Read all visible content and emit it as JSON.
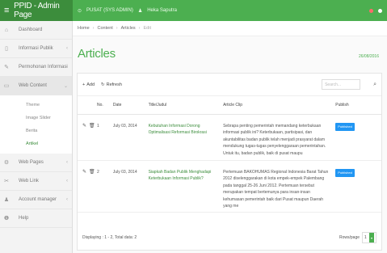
{
  "app": {
    "title": "PPID - Admin Page"
  },
  "topnav": {
    "org": "PUSAT (SYS ADMIN)",
    "user": "Heka Saputra"
  },
  "sidebar": {
    "items": [
      {
        "label": "Dashboard",
        "icon": "home-icon"
      },
      {
        "label": "Informasi Publik",
        "icon": "file-icon"
      },
      {
        "label": "Permohonan Informasi",
        "icon": "edit-icon"
      },
      {
        "label": "Web Content",
        "icon": "document-icon"
      },
      {
        "label": "Web Pages",
        "icon": "gear-icon"
      },
      {
        "label": "Web Link",
        "icon": "link-icon"
      },
      {
        "label": "Account manager",
        "icon": "user-icon"
      },
      {
        "label": "Help",
        "icon": "info-icon"
      }
    ],
    "submenu": [
      "Theme",
      "Image Slider",
      "Berita",
      "Artikel"
    ]
  },
  "breadcrumb": {
    "home": "Home",
    "content": "Content",
    "articles": "Articles",
    "edit": "Edit"
  },
  "page": {
    "title": "Articles",
    "date": "26/08/2016"
  },
  "toolbar": {
    "add": "Add",
    "refresh": "Refresh",
    "search_placeholder": "Search..."
  },
  "table": {
    "headers": [
      "No.",
      "Date",
      "Title/Judul",
      "Article Clip",
      "Publish"
    ],
    "rows": [
      {
        "no": "1",
        "date": "July 03, 2014",
        "title": "Kebutuhan Informasi Dorong Optimalisasi Reformasi Birokrasi",
        "clip": "Sebrapa penting pemerintah memandang keterbukaan informasi publik ini? Keterbukaan, partisipasi, dan akuntabilitas badan publik telah menjadi prasyarat dalam mendukung tugas-tugas penyelenggaraan pemerintahan. Untuk itu, badan publik, baik di pusat maupu",
        "publish": "Published"
      },
      {
        "no": "2",
        "date": "July 03, 2014",
        "title": "Siapkah Badan Publik Menghadapi Keterbukaan Informasi Publik?",
        "clip": "Pertemuan BAKOHUMAS Regional Indonesia Barat Tahun 2012 diselenggarakan di kota empek-empek Palembang pada tanggal 25-26 Juni 2012. Pertemuan tersebut merupakan tempat bertemunya para insan-insan kehumasan pemerintah baik dari Pusat maupun Daerah yang me",
        "publish": "Published"
      }
    ]
  },
  "footer": {
    "info": "Displaying : 1 - 2, Total data: 2",
    "rows_label": "Rows/page",
    "rows_value": "1"
  },
  "colors": {
    "brand": "#3c8d3c",
    "accent": "#4caf50",
    "badge": "#2196f3"
  }
}
